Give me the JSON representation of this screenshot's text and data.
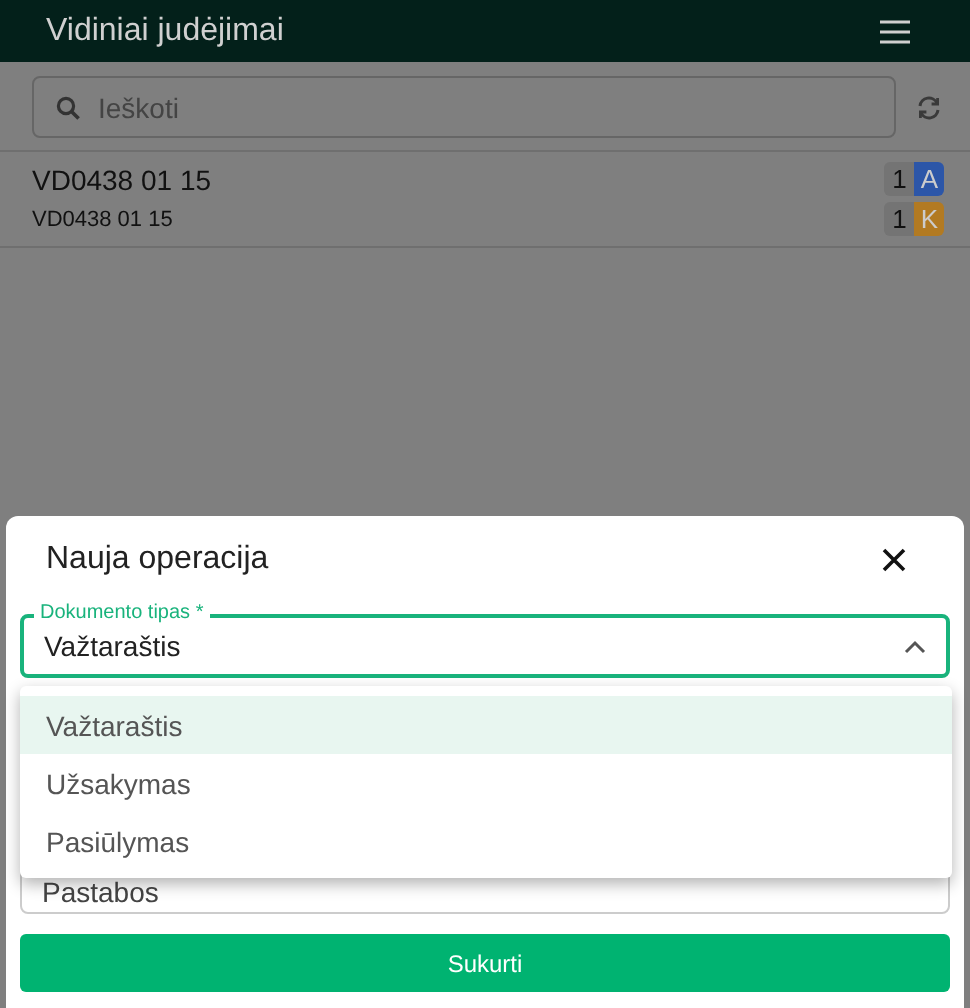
{
  "app_bar": {
    "title": "Vidiniai judėjimai"
  },
  "search": {
    "placeholder": "Ieškoti"
  },
  "list": [
    {
      "title": "VD0438 01 15",
      "subtitle": "VD0438 01 15",
      "badges": [
        {
          "count": "1",
          "letter": "A",
          "color": "#2c56a8"
        },
        {
          "count": "1",
          "letter": "K",
          "color": "#b27a22"
        }
      ]
    }
  ],
  "dialog": {
    "title": "Nauja operacija",
    "select": {
      "label": "Dokumento tipas *",
      "value": "Važtaraštis",
      "expanded": true,
      "options": [
        {
          "label": "Važtaraštis",
          "selected": true
        },
        {
          "label": "Užsakymas",
          "selected": false
        },
        {
          "label": "Pasiūlymas",
          "selected": false
        }
      ]
    },
    "notes": {
      "placeholder": "Pastabos"
    },
    "submit": "Sukurti"
  }
}
